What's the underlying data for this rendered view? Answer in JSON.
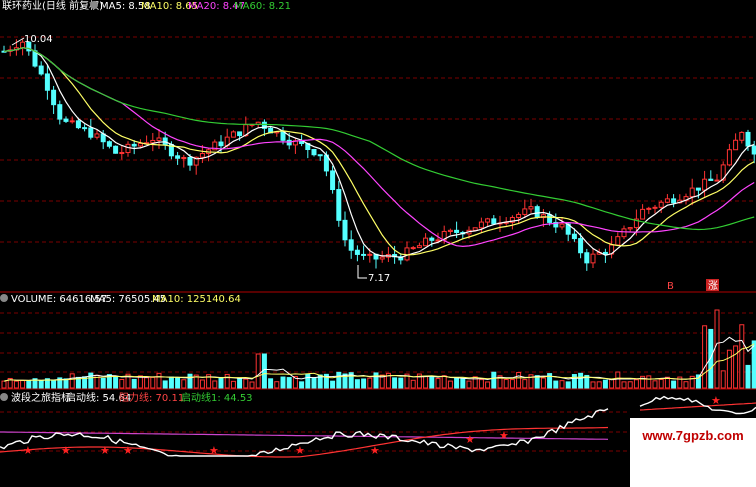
{
  "header": {
    "title": "联环药业(日线 前复权)",
    "ma": [
      {
        "text": "MA5: 8.58",
        "color": "#ffffff"
      },
      {
        "text": "MA10: 8.65",
        "color": "#ffff66"
      },
      {
        "text": "MA20: 8.47",
        "color": "#ff44ff"
      },
      {
        "text": "MA60: 8.21",
        "color": "#33cc33"
      }
    ]
  },
  "price_panel": {
    "high_label": "10.04",
    "low_label": "7.17",
    "markers": [
      {
        "text": "B",
        "color": "#ff4444"
      },
      {
        "text": "涨",
        "color": "#ffffff",
        "bg": "#cc2222"
      }
    ]
  },
  "volume_panel": {
    "header": [
      {
        "text": "VOLUME: 64616.57",
        "color": "#ffffff"
      },
      {
        "text": "MA5: 76505.45",
        "color": "#ffffff"
      },
      {
        "text": "MA10: 125140.64",
        "color": "#ffff66"
      }
    ]
  },
  "indicator_panel": {
    "header": [
      {
        "text": "波段之旅指标",
        "color": "#ffffff"
      },
      {
        "text": "启动线: 54.64",
        "color": "#ffffff"
      },
      {
        "text": "阻力线: 70.11",
        "color": "#ff4444"
      },
      {
        "text": "启动线1: 44.53",
        "color": "#33cc33"
      }
    ]
  },
  "watermark": "www.7gpzb.com",
  "chart_data": {
    "type": "candlestick",
    "title": "联环药业(日线 前复权)",
    "price_range": [
      7.17,
      10.04
    ],
    "series": [
      {
        "name": "MA5",
        "last": 8.58
      },
      {
        "name": "MA10",
        "last": 8.65
      },
      {
        "name": "MA20",
        "last": 8.47
      },
      {
        "name": "MA60",
        "last": 8.21
      }
    ],
    "volume": {
      "VOLUME": 64616.57,
      "MA5": 76505.45,
      "MA10": 125140.64
    },
    "indicator": {
      "name": "波段之旅指标",
      "启动线": 54.64,
      "阻力线": 70.11,
      "启动线1": 44.53
    },
    "colors": {
      "up": "#ff3333",
      "down": "#54ffff",
      "grid": "#7a0000",
      "border": "#aa0000"
    }
  }
}
